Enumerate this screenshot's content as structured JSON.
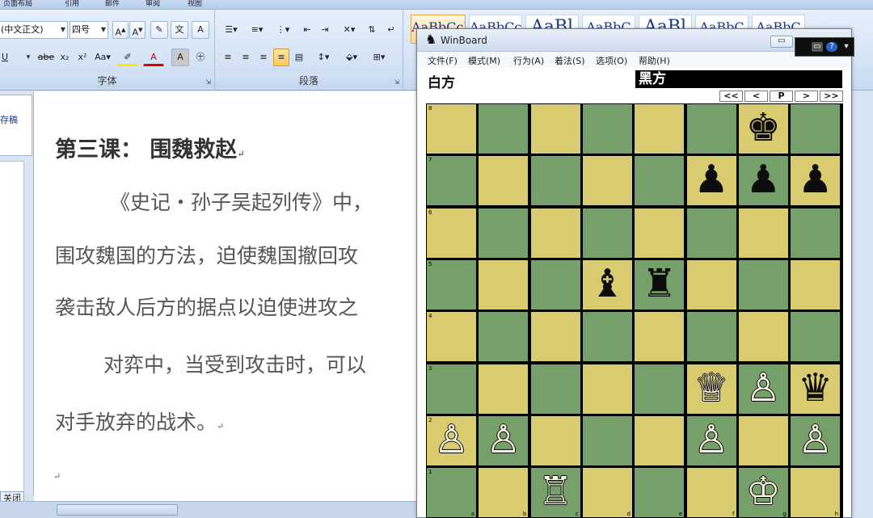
{
  "ribbon": {
    "tabs": [
      "页面布局",
      "引用",
      "邮件",
      "审阅",
      "视图"
    ],
    "font_name": "(中文正文)",
    "font_size": "四号",
    "font_group_label": "字体",
    "para_group_label": "段落",
    "style_samples": [
      "AaBbCcDd",
      "AaBbCcDd",
      "AaBl",
      "AaBbC",
      "AaBl",
      "AaBbC",
      "AaBbC"
    ]
  },
  "left_pane": {
    "tab_label": "存稿",
    "close_label": "关闭"
  },
  "document": {
    "title": "第三课：  围魏救赵",
    "lines": [
      "《史记・孙子吴起列传》中，",
      "围攻魏国的方法，迫使魏国撤回攻",
      "袭击敌人后方的据点以迫使进攻之",
      "对弈中，当受到攻击时，可以",
      "对手放弃的战术。"
    ],
    "para_mark": "↵"
  },
  "winboard": {
    "title": "WinBoard",
    "menu": [
      "文件(F)",
      "模式(M)",
      "行为(A)",
      "着法(S)",
      "选项(O)",
      "帮助(H)"
    ],
    "white_label": "白方",
    "black_label": "黑方",
    "nav_buttons": [
      "<<",
      "<",
      "P",
      ">",
      ">>"
    ],
    "minimize_symbol": "▭",
    "files": [
      "a",
      "b",
      "c",
      "d",
      "e",
      "f",
      "g",
      "h"
    ],
    "ranks": [
      "8",
      "7",
      "6",
      "5",
      "4",
      "3",
      "2",
      "1"
    ],
    "pieces": [
      {
        "square": "g8",
        "glyph": "♚",
        "color": "black",
        "name": "black-king"
      },
      {
        "square": "f7",
        "glyph": "♟",
        "color": "black",
        "name": "black-pawn"
      },
      {
        "square": "g7",
        "glyph": "♟",
        "color": "black",
        "name": "black-pawn"
      },
      {
        "square": "h7",
        "glyph": "♟",
        "color": "black",
        "name": "black-pawn"
      },
      {
        "square": "d5",
        "glyph": "♝",
        "color": "black",
        "name": "black-bishop"
      },
      {
        "square": "e5",
        "glyph": "♜",
        "color": "black",
        "name": "black-rook"
      },
      {
        "square": "f3",
        "glyph": "♕",
        "color": "white",
        "name": "white-queen"
      },
      {
        "square": "g3",
        "glyph": "♙",
        "color": "white",
        "name": "white-pawn"
      },
      {
        "square": "h3",
        "glyph": "♛",
        "color": "black",
        "name": "black-queen"
      },
      {
        "square": "a2",
        "glyph": "♙",
        "color": "white",
        "name": "white-pawn"
      },
      {
        "square": "b2",
        "glyph": "♙",
        "color": "white",
        "name": "white-pawn"
      },
      {
        "square": "f2",
        "glyph": "♙",
        "color": "white",
        "name": "white-pawn"
      },
      {
        "square": "h2",
        "glyph": "♙",
        "color": "white",
        "name": "white-pawn"
      },
      {
        "square": "c1",
        "glyph": "♖",
        "color": "white",
        "name": "white-rook"
      },
      {
        "square": "g1",
        "glyph": "♔",
        "color": "white",
        "name": "white-king"
      }
    ],
    "colors": {
      "light_square": "#d9cb70",
      "dark_square": "#76a06a"
    }
  },
  "overlay": {
    "help_symbol": "?"
  }
}
